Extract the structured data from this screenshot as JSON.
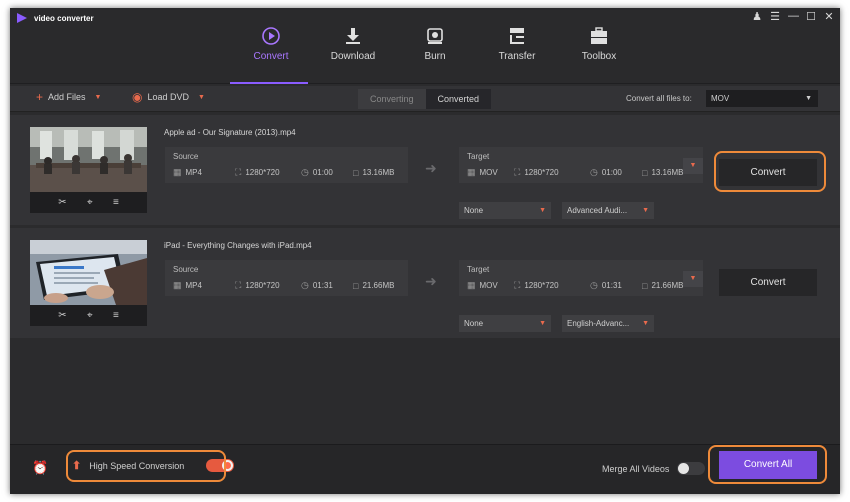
{
  "app": {
    "title": "video converter"
  },
  "window_controls": [
    "user-icon",
    "menu-icon",
    "minimize-icon",
    "maximize-icon",
    "close-icon"
  ],
  "nav": {
    "items": [
      {
        "label": "Convert",
        "icon": "convert-icon",
        "active": true
      },
      {
        "label": "Download",
        "icon": "download-icon",
        "active": false
      },
      {
        "label": "Burn",
        "icon": "burn-icon",
        "active": false
      },
      {
        "label": "Transfer",
        "icon": "transfer-icon",
        "active": false
      },
      {
        "label": "Toolbox",
        "icon": "toolbox-icon",
        "active": false
      }
    ]
  },
  "toolbar": {
    "add_files": "Add Files",
    "load_dvd": "Load DVD",
    "tab_converting": "Converting",
    "tab_converted": "Converted",
    "active_tab": "Converted",
    "convert_all_label": "Convert all files to:",
    "convert_all_format": "MOV"
  },
  "files": [
    {
      "name": "Apple ad - Our Signature (2013).mp4",
      "source": {
        "label": "Source",
        "format": "MP4",
        "resolution": "1280*720",
        "duration": "01:00",
        "size": "13.16MB"
      },
      "target": {
        "label": "Target",
        "format": "MOV",
        "resolution": "1280*720",
        "duration": "01:00",
        "size": "13.16MB"
      },
      "subtitle": "None",
      "audio": "Advanced Audi...",
      "convert_label": "Convert",
      "highlighted": true
    },
    {
      "name": "iPad - Everything Changes with iPad.mp4",
      "source": {
        "label": "Source",
        "format": "MP4",
        "resolution": "1280*720",
        "duration": "01:31",
        "size": "21.66MB"
      },
      "target": {
        "label": "Target",
        "format": "MOV",
        "resolution": "1280*720",
        "duration": "01:31",
        "size": "21.66MB"
      },
      "subtitle": "None",
      "audio": "English-Advanc...",
      "convert_label": "Convert",
      "highlighted": false
    }
  ],
  "bottom": {
    "high_speed_label": "High Speed Conversion",
    "high_speed_on": true,
    "merge_label": "Merge All Videos",
    "merge_on": false,
    "convert_all": "Convert All"
  },
  "colors": {
    "accent": "#8a5cff",
    "orange": "#e96a4d",
    "highlight": "#ee8a3a",
    "convert_all_bg": "#7c4ce0"
  }
}
